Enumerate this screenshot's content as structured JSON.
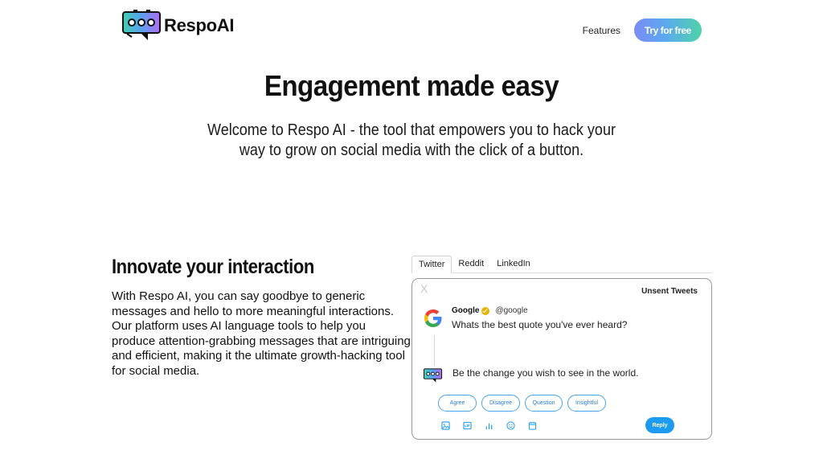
{
  "header": {
    "brand": "RespoAI",
    "nav": {
      "features": "Features",
      "cta": "Try for free"
    }
  },
  "hero": {
    "title": "Engagement made easy",
    "subtitle": "Welcome to Respo AI - the tool that empowers you to hack your way to grow on social media with the click of a button."
  },
  "section": {
    "title": "Innovate your interaction",
    "body": "With Respo AI, you can say goodbye to generic messages and hello to more meaningful interactions. Our platform uses AI language tools to help you produce attention-grabbing messages that are intriguing and efficient, making it the ultimate growth-hacking tool for social media."
  },
  "tabs": [
    {
      "label": "Twitter",
      "active": true
    },
    {
      "label": "Reddit",
      "active": false
    },
    {
      "label": "LinkedIn",
      "active": false
    }
  ],
  "card": {
    "close": "X",
    "unsent_label": "Unsent Tweets",
    "tweet": {
      "author": "Google",
      "handle": "@google",
      "text": "Whats the best quote you've ever heard?"
    },
    "reply_text": "Be the change you wish to see in the world.",
    "chips": [
      "Agree",
      "Disagree",
      "Question",
      "Insightful"
    ],
    "tools": [
      "image-icon",
      "gif-icon",
      "poll-icon",
      "emoji-icon",
      "schedule-icon"
    ],
    "reply_button": "Reply"
  },
  "colors": {
    "cta_gradient": [
      "#7a8cf5",
      "#5ca8f0",
      "#4fd3a8"
    ],
    "twitter_blue": "#1d9bf0"
  }
}
